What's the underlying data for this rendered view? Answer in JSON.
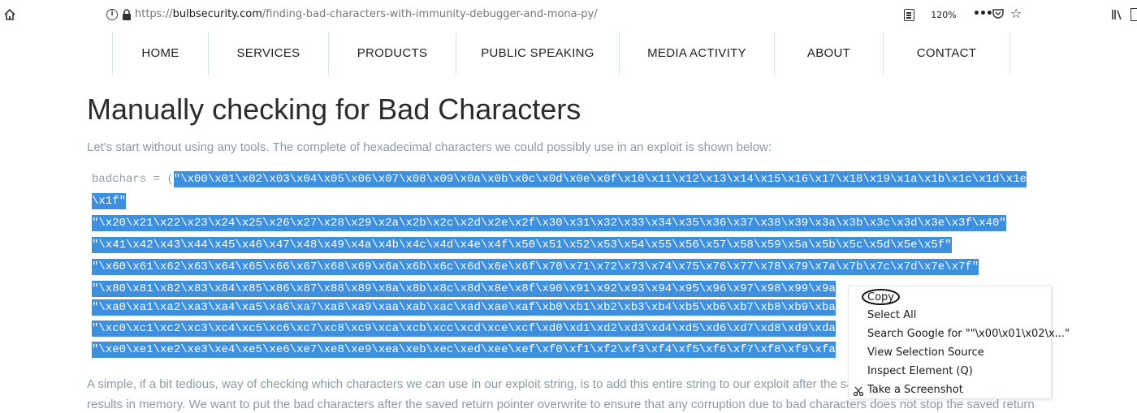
{
  "browser": {
    "url_prefix": "https://",
    "url_domain": "bulbsecurity.com",
    "url_path": "/finding-bad-characters-with-immunity-debugger-and-mona-py/",
    "zoom": "120%",
    "info_glyph": "i",
    "more_glyph": "•••",
    "star_glyph": "☆"
  },
  "nav": {
    "items": [
      "HOME",
      "SERVICES",
      "PRODUCTS",
      "PUBLIC SPEAKING",
      "MEDIA ACTIVITY",
      "ABOUT",
      "CONTACT"
    ]
  },
  "article": {
    "title": "Manually checking for Bad Characters",
    "intro": "Let's start without using any tools. The complete of hexadecimal characters we could possibly use in an exploit is shown below:",
    "code_prefix": "badchars = (",
    "code_lines": [
      "\"\\x00\\x01\\x02\\x03\\x04\\x05\\x06\\x07\\x08\\x09\\x0a\\x0b\\x0c\\x0d\\x0e\\x0f\\x10\\x11\\x12\\x13\\x14\\x15\\x16\\x17\\x18\\x19\\x1a\\x1b\\x1c\\x1d\\x1e",
      "\\x1f\"",
      "\"\\x20\\x21\\x22\\x23\\x24\\x25\\x26\\x27\\x28\\x29\\x2a\\x2b\\x2c\\x2d\\x2e\\x2f\\x30\\x31\\x32\\x33\\x34\\x35\\x36\\x37\\x38\\x39\\x3a\\x3b\\x3c\\x3d\\x3e\\x3f\\x40\"",
      "\"\\x41\\x42\\x43\\x44\\x45\\x46\\x47\\x48\\x49\\x4a\\x4b\\x4c\\x4d\\x4e\\x4f\\x50\\x51\\x52\\x53\\x54\\x55\\x56\\x57\\x58\\x59\\x5a\\x5b\\x5c\\x5d\\x5e\\x5f\"",
      "\"\\x60\\x61\\x62\\x63\\x64\\x65\\x66\\x67\\x68\\x69\\x6a\\x6b\\x6c\\x6d\\x6e\\x6f\\x70\\x71\\x72\\x73\\x74\\x75\\x76\\x77\\x78\\x79\\x7a\\x7b\\x7c\\x7d\\x7e\\x7f\"",
      "\"\\x80\\x81\\x82\\x83\\x84\\x85\\x86\\x87\\x88\\x89\\x8a\\x8b\\x8c\\x8d\\x8e\\x8f\\x90\\x91\\x92\\x93\\x94\\x95\\x96\\x97\\x98\\x99\\x9a",
      "\"\\xa0\\xa1\\xa2\\xa3\\xa4\\xa5\\xa6\\xa7\\xa8\\xa9\\xaa\\xab\\xac\\xad\\xae\\xaf\\xb0\\xb1\\xb2\\xb3\\xb4\\xb5\\xb6\\xb7\\xb8\\xb9\\xba",
      "\"\\xc0\\xc1\\xc2\\xc3\\xc4\\xc5\\xc6\\xc7\\xc8\\xc9\\xca\\xcb\\xcc\\xcd\\xce\\xcf\\xd0\\xd1\\xd2\\xd3\\xd4\\xd5\\xd6\\xd7\\xd8\\xd9\\xda",
      "\"\\xe0\\xe1\\xe2\\xe3\\xe4\\xe5\\xe6\\xe7\\xe8\\xe9\\xea\\xeb\\xec\\xed\\xee\\xef\\xf0\\xf1\\xf2\\xf3\\xf4\\xf5\\xf6\\xf7\\xf8\\xf9\\xfa"
    ],
    "para_lines": [
      "A simple, if a bit tedious, way of checking which characters we can use in our exploit string, is to add this entire string to our exploit after the saved",
      "results in memory. We want to put the bad characters after the saved return pointer overwrite to ensure that any corruption due to bad characters does not stop the saved return"
    ]
  },
  "context_menu": {
    "items": [
      "Copy",
      "Select All",
      "Search Google for \"\"\\x00\\x01\\x02\\x...\"",
      "View Selection Source",
      "Inspect Element (Q)",
      "Take a Screenshot"
    ]
  },
  "colors": {
    "selection": "#3d8fe0",
    "nav_divider": "#cfe6e6",
    "muted_text": "#8a9aa3"
  }
}
